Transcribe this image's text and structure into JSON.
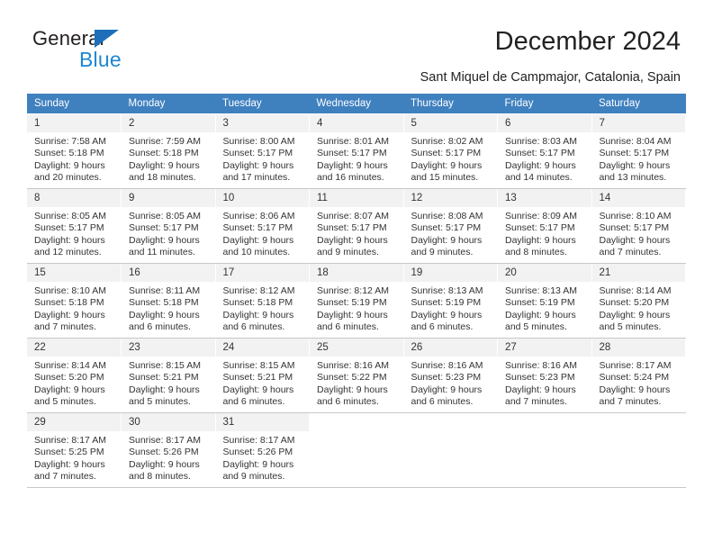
{
  "brand": {
    "name_dark": "General",
    "name_light": "Blue",
    "triangle_color": "#1c6fb8",
    "accent_color": "#1f86d0"
  },
  "header": {
    "title": "December 2024",
    "subtitle": "Sant Miquel de Campmajor, Catalonia, Spain"
  },
  "calendar": {
    "header_bg": "#3f80bf",
    "daynum_bg": "#f2f2f2",
    "weekdays": [
      "Sunday",
      "Monday",
      "Tuesday",
      "Wednesday",
      "Thursday",
      "Friday",
      "Saturday"
    ],
    "weeks": [
      [
        {
          "day": "1",
          "sunrise": "Sunrise: 7:58 AM",
          "sunset": "Sunset: 5:18 PM",
          "daylight1": "Daylight: 9 hours",
          "daylight2": "and 20 minutes."
        },
        {
          "day": "2",
          "sunrise": "Sunrise: 7:59 AM",
          "sunset": "Sunset: 5:18 PM",
          "daylight1": "Daylight: 9 hours",
          "daylight2": "and 18 minutes."
        },
        {
          "day": "3",
          "sunrise": "Sunrise: 8:00 AM",
          "sunset": "Sunset: 5:17 PM",
          "daylight1": "Daylight: 9 hours",
          "daylight2": "and 17 minutes."
        },
        {
          "day": "4",
          "sunrise": "Sunrise: 8:01 AM",
          "sunset": "Sunset: 5:17 PM",
          "daylight1": "Daylight: 9 hours",
          "daylight2": "and 16 minutes."
        },
        {
          "day": "5",
          "sunrise": "Sunrise: 8:02 AM",
          "sunset": "Sunset: 5:17 PM",
          "daylight1": "Daylight: 9 hours",
          "daylight2": "and 15 minutes."
        },
        {
          "day": "6",
          "sunrise": "Sunrise: 8:03 AM",
          "sunset": "Sunset: 5:17 PM",
          "daylight1": "Daylight: 9 hours",
          "daylight2": "and 14 minutes."
        },
        {
          "day": "7",
          "sunrise": "Sunrise: 8:04 AM",
          "sunset": "Sunset: 5:17 PM",
          "daylight1": "Daylight: 9 hours",
          "daylight2": "and 13 minutes."
        }
      ],
      [
        {
          "day": "8",
          "sunrise": "Sunrise: 8:05 AM",
          "sunset": "Sunset: 5:17 PM",
          "daylight1": "Daylight: 9 hours",
          "daylight2": "and 12 minutes."
        },
        {
          "day": "9",
          "sunrise": "Sunrise: 8:05 AM",
          "sunset": "Sunset: 5:17 PM",
          "daylight1": "Daylight: 9 hours",
          "daylight2": "and 11 minutes."
        },
        {
          "day": "10",
          "sunrise": "Sunrise: 8:06 AM",
          "sunset": "Sunset: 5:17 PM",
          "daylight1": "Daylight: 9 hours",
          "daylight2": "and 10 minutes."
        },
        {
          "day": "11",
          "sunrise": "Sunrise: 8:07 AM",
          "sunset": "Sunset: 5:17 PM",
          "daylight1": "Daylight: 9 hours",
          "daylight2": "and 9 minutes."
        },
        {
          "day": "12",
          "sunrise": "Sunrise: 8:08 AM",
          "sunset": "Sunset: 5:17 PM",
          "daylight1": "Daylight: 9 hours",
          "daylight2": "and 9 minutes."
        },
        {
          "day": "13",
          "sunrise": "Sunrise: 8:09 AM",
          "sunset": "Sunset: 5:17 PM",
          "daylight1": "Daylight: 9 hours",
          "daylight2": "and 8 minutes."
        },
        {
          "day": "14",
          "sunrise": "Sunrise: 8:10 AM",
          "sunset": "Sunset: 5:17 PM",
          "daylight1": "Daylight: 9 hours",
          "daylight2": "and 7 minutes."
        }
      ],
      [
        {
          "day": "15",
          "sunrise": "Sunrise: 8:10 AM",
          "sunset": "Sunset: 5:18 PM",
          "daylight1": "Daylight: 9 hours",
          "daylight2": "and 7 minutes."
        },
        {
          "day": "16",
          "sunrise": "Sunrise: 8:11 AM",
          "sunset": "Sunset: 5:18 PM",
          "daylight1": "Daylight: 9 hours",
          "daylight2": "and 6 minutes."
        },
        {
          "day": "17",
          "sunrise": "Sunrise: 8:12 AM",
          "sunset": "Sunset: 5:18 PM",
          "daylight1": "Daylight: 9 hours",
          "daylight2": "and 6 minutes."
        },
        {
          "day": "18",
          "sunrise": "Sunrise: 8:12 AM",
          "sunset": "Sunset: 5:19 PM",
          "daylight1": "Daylight: 9 hours",
          "daylight2": "and 6 minutes."
        },
        {
          "day": "19",
          "sunrise": "Sunrise: 8:13 AM",
          "sunset": "Sunset: 5:19 PM",
          "daylight1": "Daylight: 9 hours",
          "daylight2": "and 6 minutes."
        },
        {
          "day": "20",
          "sunrise": "Sunrise: 8:13 AM",
          "sunset": "Sunset: 5:19 PM",
          "daylight1": "Daylight: 9 hours",
          "daylight2": "and 5 minutes."
        },
        {
          "day": "21",
          "sunrise": "Sunrise: 8:14 AM",
          "sunset": "Sunset: 5:20 PM",
          "daylight1": "Daylight: 9 hours",
          "daylight2": "and 5 minutes."
        }
      ],
      [
        {
          "day": "22",
          "sunrise": "Sunrise: 8:14 AM",
          "sunset": "Sunset: 5:20 PM",
          "daylight1": "Daylight: 9 hours",
          "daylight2": "and 5 minutes."
        },
        {
          "day": "23",
          "sunrise": "Sunrise: 8:15 AM",
          "sunset": "Sunset: 5:21 PM",
          "daylight1": "Daylight: 9 hours",
          "daylight2": "and 5 minutes."
        },
        {
          "day": "24",
          "sunrise": "Sunrise: 8:15 AM",
          "sunset": "Sunset: 5:21 PM",
          "daylight1": "Daylight: 9 hours",
          "daylight2": "and 6 minutes."
        },
        {
          "day": "25",
          "sunrise": "Sunrise: 8:16 AM",
          "sunset": "Sunset: 5:22 PM",
          "daylight1": "Daylight: 9 hours",
          "daylight2": "and 6 minutes."
        },
        {
          "day": "26",
          "sunrise": "Sunrise: 8:16 AM",
          "sunset": "Sunset: 5:23 PM",
          "daylight1": "Daylight: 9 hours",
          "daylight2": "and 6 minutes."
        },
        {
          "day": "27",
          "sunrise": "Sunrise: 8:16 AM",
          "sunset": "Sunset: 5:23 PM",
          "daylight1": "Daylight: 9 hours",
          "daylight2": "and 7 minutes."
        },
        {
          "day": "28",
          "sunrise": "Sunrise: 8:17 AM",
          "sunset": "Sunset: 5:24 PM",
          "daylight1": "Daylight: 9 hours",
          "daylight2": "and 7 minutes."
        }
      ],
      [
        {
          "day": "29",
          "sunrise": "Sunrise: 8:17 AM",
          "sunset": "Sunset: 5:25 PM",
          "daylight1": "Daylight: 9 hours",
          "daylight2": "and 7 minutes."
        },
        {
          "day": "30",
          "sunrise": "Sunrise: 8:17 AM",
          "sunset": "Sunset: 5:26 PM",
          "daylight1": "Daylight: 9 hours",
          "daylight2": "and 8 minutes."
        },
        {
          "day": "31",
          "sunrise": "Sunrise: 8:17 AM",
          "sunset": "Sunset: 5:26 PM",
          "daylight1": "Daylight: 9 hours",
          "daylight2": "and 9 minutes."
        },
        {
          "day": "",
          "sunrise": "",
          "sunset": "",
          "daylight1": "",
          "daylight2": ""
        },
        {
          "day": "",
          "sunrise": "",
          "sunset": "",
          "daylight1": "",
          "daylight2": ""
        },
        {
          "day": "",
          "sunrise": "",
          "sunset": "",
          "daylight1": "",
          "daylight2": ""
        },
        {
          "day": "",
          "sunrise": "",
          "sunset": "",
          "daylight1": "",
          "daylight2": ""
        }
      ]
    ]
  }
}
